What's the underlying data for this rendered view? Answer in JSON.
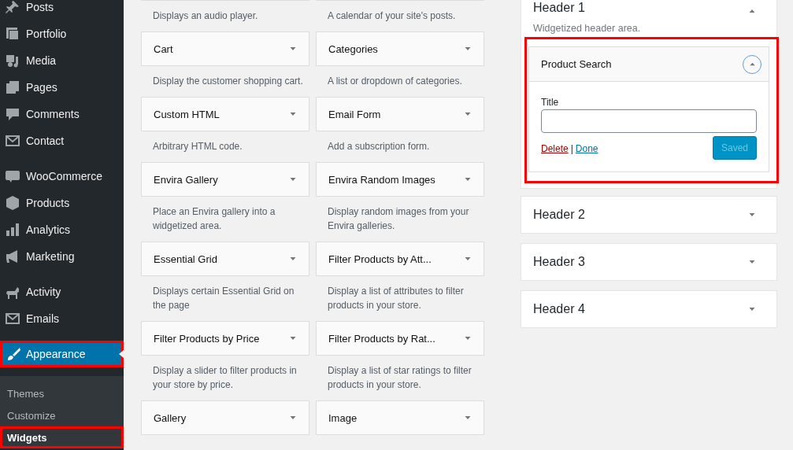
{
  "sidebar": {
    "menu_groups": [
      {
        "items": [
          {
            "label": "Posts",
            "selected": false,
            "highlighted": false
          },
          {
            "label": "Portfolio",
            "selected": false,
            "highlighted": false
          },
          {
            "label": "Media",
            "selected": false,
            "highlighted": false
          },
          {
            "label": "Pages",
            "selected": false,
            "highlighted": false
          },
          {
            "label": "Comments",
            "selected": false,
            "highlighted": false
          },
          {
            "label": "Contact",
            "selected": false,
            "highlighted": false
          }
        ]
      },
      {
        "items": [
          {
            "label": "WooCommerce",
            "selected": false,
            "highlighted": false
          },
          {
            "label": "Products",
            "selected": false,
            "highlighted": false
          },
          {
            "label": "Analytics",
            "selected": false,
            "highlighted": false
          },
          {
            "label": "Marketing",
            "selected": false,
            "highlighted": false
          }
        ]
      },
      {
        "items": [
          {
            "label": "Activity",
            "selected": false,
            "highlighted": false
          },
          {
            "label": "Emails",
            "selected": false,
            "highlighted": false
          }
        ]
      },
      {
        "items": [
          {
            "label": "Appearance",
            "selected": true,
            "highlighted": true
          }
        ]
      }
    ],
    "submenu": [
      {
        "label": "Themes",
        "selected": false,
        "highlighted": false
      },
      {
        "label": "Customize",
        "selected": false,
        "highlighted": false
      },
      {
        "label": "Widgets",
        "selected": true,
        "highlighted": true
      }
    ]
  },
  "available_widgets": {
    "columns": [
      [
        {
          "description": "Displays an audio player."
        },
        {
          "title": "Cart",
          "description": "Display the customer shopping cart."
        },
        {
          "title": "Custom HTML",
          "description": "Arbitrary HTML code."
        },
        {
          "title": "Envira Gallery",
          "description": "Place an Envira gallery into a widgetized area."
        },
        {
          "title": "Essential Grid",
          "description": "Displays certain Essential Grid on the page"
        },
        {
          "title": "Filter Products by Price",
          "description": "Display a slider to filter products in your store by price."
        },
        {
          "title": "Gallery"
        }
      ],
      [
        {
          "description": "A calendar of your site's posts."
        },
        {
          "title": "Categories",
          "description": "A list or dropdown of categories."
        },
        {
          "title": "Email Form",
          "description": "Add a subscription form."
        },
        {
          "title": "Envira Random Images",
          "description": "Display random images from your Envira galleries."
        },
        {
          "title": "Filter Products by Att...",
          "description": "Display a list of attributes to filter products in your store."
        },
        {
          "title": "Filter Products by Rat...",
          "description": "Display a list of star ratings to filter products in your store."
        },
        {
          "title": "Image"
        }
      ]
    ]
  },
  "sidebars": [
    {
      "title": "Header 1",
      "expanded": true,
      "description": "Widgetized header area.",
      "widgets": [
        {
          "title": "Product Search",
          "expanded": true,
          "highlighted": true,
          "fields": [
            {
              "label": "Title"
            }
          ],
          "delete_link": "Delete",
          "separator": "|",
          "done_link": "Done",
          "save_button": {
            "label": "Saved",
            "disabled": true
          }
        }
      ]
    },
    {
      "title": "Header 2",
      "expanded": false
    },
    {
      "title": "Header 3",
      "expanded": false
    },
    {
      "title": "Header 4",
      "expanded": false
    }
  ]
}
